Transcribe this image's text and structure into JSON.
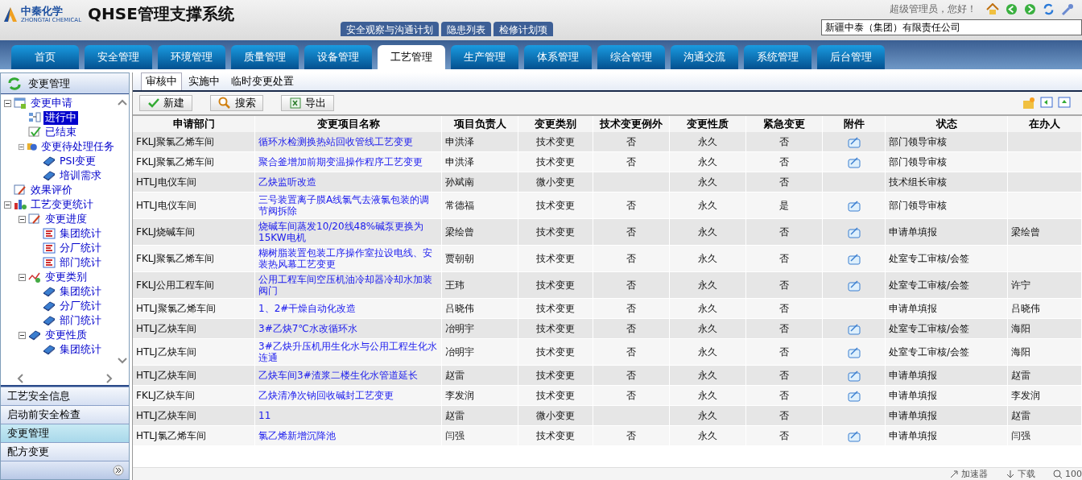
{
  "header": {
    "logo_cn": "中秦化学",
    "logo_en": "ZHONGTAI CHEMICAL",
    "title": "QHSE管理支撑系统",
    "greeting": "超级管理员，您好！",
    "company": "新疆中泰（集团）有限责任公司"
  },
  "sub_tabs": [
    "安全观察与沟通计划",
    "隐患列表",
    "检修计划项"
  ],
  "nav_tabs": [
    {
      "label": "首页",
      "selected": false
    },
    {
      "label": "安全管理",
      "selected": false
    },
    {
      "label": "环境管理",
      "selected": false
    },
    {
      "label": "质量管理",
      "selected": false
    },
    {
      "label": "设备管理",
      "selected": false
    },
    {
      "label": "工艺管理",
      "selected": true
    },
    {
      "label": "生产管理",
      "selected": false
    },
    {
      "label": "体系管理",
      "selected": false
    },
    {
      "label": "综合管理",
      "selected": false
    },
    {
      "label": "沟通交流",
      "selected": false
    },
    {
      "label": "系统管理",
      "selected": false
    },
    {
      "label": "后台管理",
      "selected": false
    }
  ],
  "sidebar": {
    "title": "变更管理",
    "tree": [
      {
        "label": "变更申请",
        "kind": "table",
        "expanded": true,
        "selected": false,
        "children": [
          {
            "label": "进行中",
            "kind": "flow",
            "selected": true
          },
          {
            "label": "已结束",
            "kind": "check",
            "selected": false
          },
          {
            "label": "变更待处理任务",
            "kind": "info",
            "expanded": true,
            "selected": false,
            "children": [
              {
                "label": "PSI变更",
                "kind": "book",
                "selected": false
              },
              {
                "label": "培训需求",
                "kind": "book",
                "selected": false
              }
            ]
          }
        ]
      },
      {
        "label": "效果评价",
        "kind": "edit",
        "selected": false
      },
      {
        "label": "工艺变更统计",
        "kind": "chart",
        "expanded": true,
        "selected": false,
        "children": [
          {
            "label": "变更进度",
            "kind": "edit",
            "expanded": true,
            "selected": false,
            "children": [
              {
                "label": "集团统计",
                "kind": "stat",
                "selected": false
              },
              {
                "label": "分厂统计",
                "kind": "stat",
                "selected": false
              },
              {
                "label": "部门统计",
                "kind": "stat",
                "selected": false
              }
            ]
          },
          {
            "label": "变更类别",
            "kind": "graph",
            "expanded": true,
            "selected": false,
            "children": [
              {
                "label": "集团统计",
                "kind": "book",
                "selected": false
              },
              {
                "label": "分厂统计",
                "kind": "book",
                "selected": false
              },
              {
                "label": "部门统计",
                "kind": "book",
                "selected": false
              }
            ]
          },
          {
            "label": "变更性质",
            "kind": "book",
            "expanded": true,
            "selected": false,
            "children": [
              {
                "label": "集团统计",
                "kind": "book",
                "selected": false
              }
            ]
          }
        ]
      }
    ],
    "sections": [
      {
        "label": "工艺安全信息",
        "selected": false
      },
      {
        "label": "启动前安全检查",
        "selected": false
      },
      {
        "label": "变更管理",
        "selected": true
      },
      {
        "label": "配方变更",
        "selected": false
      }
    ]
  },
  "content_tabs": [
    {
      "label": "审核中",
      "selected": true
    },
    {
      "label": "实施中",
      "selected": false
    },
    {
      "label": "临时变更处置",
      "selected": false
    }
  ],
  "toolbar": [
    "新建",
    "搜索",
    "导出"
  ],
  "table": {
    "columns": [
      "申请部门",
      "变更项目名称",
      "项目负责人",
      "变更类别",
      "技术变更例外",
      "变更性质",
      "紧急变更",
      "附件",
      "状态",
      "在办人"
    ],
    "rows": [
      {
        "dept": "FKLJ聚氯乙烯车间",
        "name": "循环水检测换热站回收管线工艺变更",
        "owner": "申洪泽",
        "type": "技术变更",
        "exception": "否",
        "nature": "永久",
        "urgent": "否",
        "attachment": true,
        "status": "部门领导审核",
        "handler": ""
      },
      {
        "dept": "FKLJ聚氯乙烯车间",
        "name": "聚合釜增加前期变温操作程序工艺变更",
        "owner": "申洪泽",
        "type": "技术变更",
        "exception": "否",
        "nature": "永久",
        "urgent": "否",
        "attachment": true,
        "status": "部门领导审核",
        "handler": ""
      },
      {
        "dept": "HTLJ电仪车间",
        "name": "乙炔监听改造",
        "owner": "孙斌南",
        "type": "微小变更",
        "exception": "",
        "nature": "永久",
        "urgent": "否",
        "attachment": false,
        "status": "技术组长审核",
        "handler": ""
      },
      {
        "dept": "HTLJ电仪车间",
        "name": "三号装置离子膜A线氯气去液氯包装的调节阀拆除",
        "owner": "常德福",
        "type": "技术变更",
        "exception": "否",
        "nature": "永久",
        "urgent": "是",
        "attachment": true,
        "status": "部门领导审核",
        "handler": ""
      },
      {
        "dept": "FKLJ烧碱车间",
        "name": "烧碱车间蒸发10/20线48%碱泵更换为15KW电机",
        "owner": "梁绘曾",
        "type": "技术变更",
        "exception": "否",
        "nature": "永久",
        "urgent": "否",
        "attachment": true,
        "status": "申请单填报",
        "handler": "梁绘曾"
      },
      {
        "dept": "FKLJ聚氯乙烯车间",
        "name": "糊树脂装置包装工序操作室拉设电线、安装热风幕工艺变更",
        "owner": "贾朝朝",
        "type": "技术变更",
        "exception": "否",
        "nature": "永久",
        "urgent": "否",
        "attachment": true,
        "status": "处室专工审核/会签",
        "handler": ""
      },
      {
        "dept": "FKLJ公用工程车间",
        "name": "公用工程车间空压机油冷却器冷却水加装阀门",
        "owner": "王玮",
        "type": "技术变更",
        "exception": "否",
        "nature": "永久",
        "urgent": "否",
        "attachment": true,
        "status": "处室专工审核/会签",
        "handler": "许宁"
      },
      {
        "dept": "HTLJ聚氯乙烯车间",
        "name": "1、2#干燥自动化改造",
        "owner": "吕晓伟",
        "type": "技术变更",
        "exception": "否",
        "nature": "永久",
        "urgent": "否",
        "attachment": false,
        "status": "申请单填报",
        "handler": "吕晓伟"
      },
      {
        "dept": "HTLJ乙炔车间",
        "name": "3#乙炔7℃水改循环水",
        "owner": "冶明宇",
        "type": "技术变更",
        "exception": "否",
        "nature": "永久",
        "urgent": "否",
        "attachment": true,
        "status": "处室专工审核/会签",
        "handler": "海阳"
      },
      {
        "dept": "HTLJ乙炔车间",
        "name": "3#乙炔升压机用生化水与公用工程生化水连通",
        "owner": "冶明宇",
        "type": "技术变更",
        "exception": "否",
        "nature": "永久",
        "urgent": "否",
        "attachment": true,
        "status": "处室专工审核/会签",
        "handler": "海阳"
      },
      {
        "dept": "HTLJ乙炔车间",
        "name": "乙炔车间3#渣浆二楼生化水管道延长",
        "owner": "赵雷",
        "type": "技术变更",
        "exception": "否",
        "nature": "永久",
        "urgent": "否",
        "attachment": true,
        "status": "申请单填报",
        "handler": "赵雷"
      },
      {
        "dept": "FKLJ乙炔车间",
        "name": "乙炔清净次钠回收碱封工艺变更",
        "owner": "李发润",
        "type": "技术变更",
        "exception": "否",
        "nature": "永久",
        "urgent": "否",
        "attachment": true,
        "status": "申请单填报",
        "handler": "李发润"
      },
      {
        "dept": "HTLJ乙炔车间",
        "name": "11",
        "owner": "赵雷",
        "type": "微小变更",
        "exception": "",
        "nature": "永久",
        "urgent": "否",
        "attachment": false,
        "status": "申请单填报",
        "handler": "赵雷"
      },
      {
        "dept": "HTLJ氯乙烯车间",
        "name": "氯乙烯新增沉降池",
        "owner": "闫强",
        "type": "技术变更",
        "exception": "否",
        "nature": "永久",
        "urgent": "否",
        "attachment": true,
        "status": "申请单填报",
        "handler": "闫强"
      }
    ]
  },
  "status_bar": [
    "加速器",
    "下载",
    "100"
  ]
}
